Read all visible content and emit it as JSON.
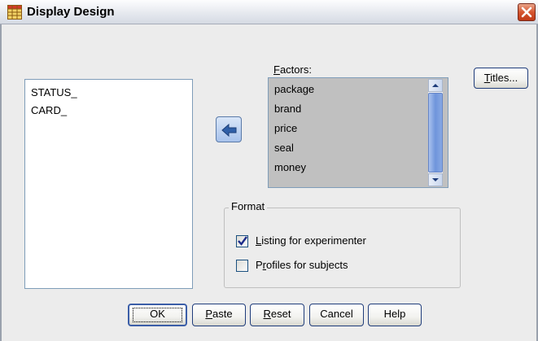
{
  "window": {
    "title": "Display Design"
  },
  "source_list": {
    "items": [
      "STATUS_",
      "CARD_"
    ]
  },
  "factors": {
    "label_mnemonic": "F",
    "label_rest": "actors:",
    "items": [
      "package",
      "brand",
      "price",
      "seal",
      "money"
    ]
  },
  "buttons": {
    "titles": {
      "mnemonic": "T",
      "rest": "itles..."
    },
    "ok": "OK",
    "paste": {
      "mnemonic": "P",
      "rest": "aste"
    },
    "reset": {
      "mnemonic": "R",
      "rest": "eset"
    },
    "cancel": "Cancel",
    "help": "Help"
  },
  "format": {
    "legend": "Format",
    "listing": {
      "mnemonic": "L",
      "rest": "isting for experimenter",
      "checked": true
    },
    "profiles": {
      "before": "P",
      "mnemonic": "r",
      "rest": "ofiles for subjects",
      "checked": false
    }
  },
  "colors": {
    "selected_list_bg": "#c0c0c0",
    "accent_blue": "#6f95db",
    "close_red": "#c13a17"
  },
  "icons": {
    "app": "grid-table-icon",
    "close": "close-icon",
    "move": "arrow-left-icon",
    "check": "checkmark-icon"
  }
}
